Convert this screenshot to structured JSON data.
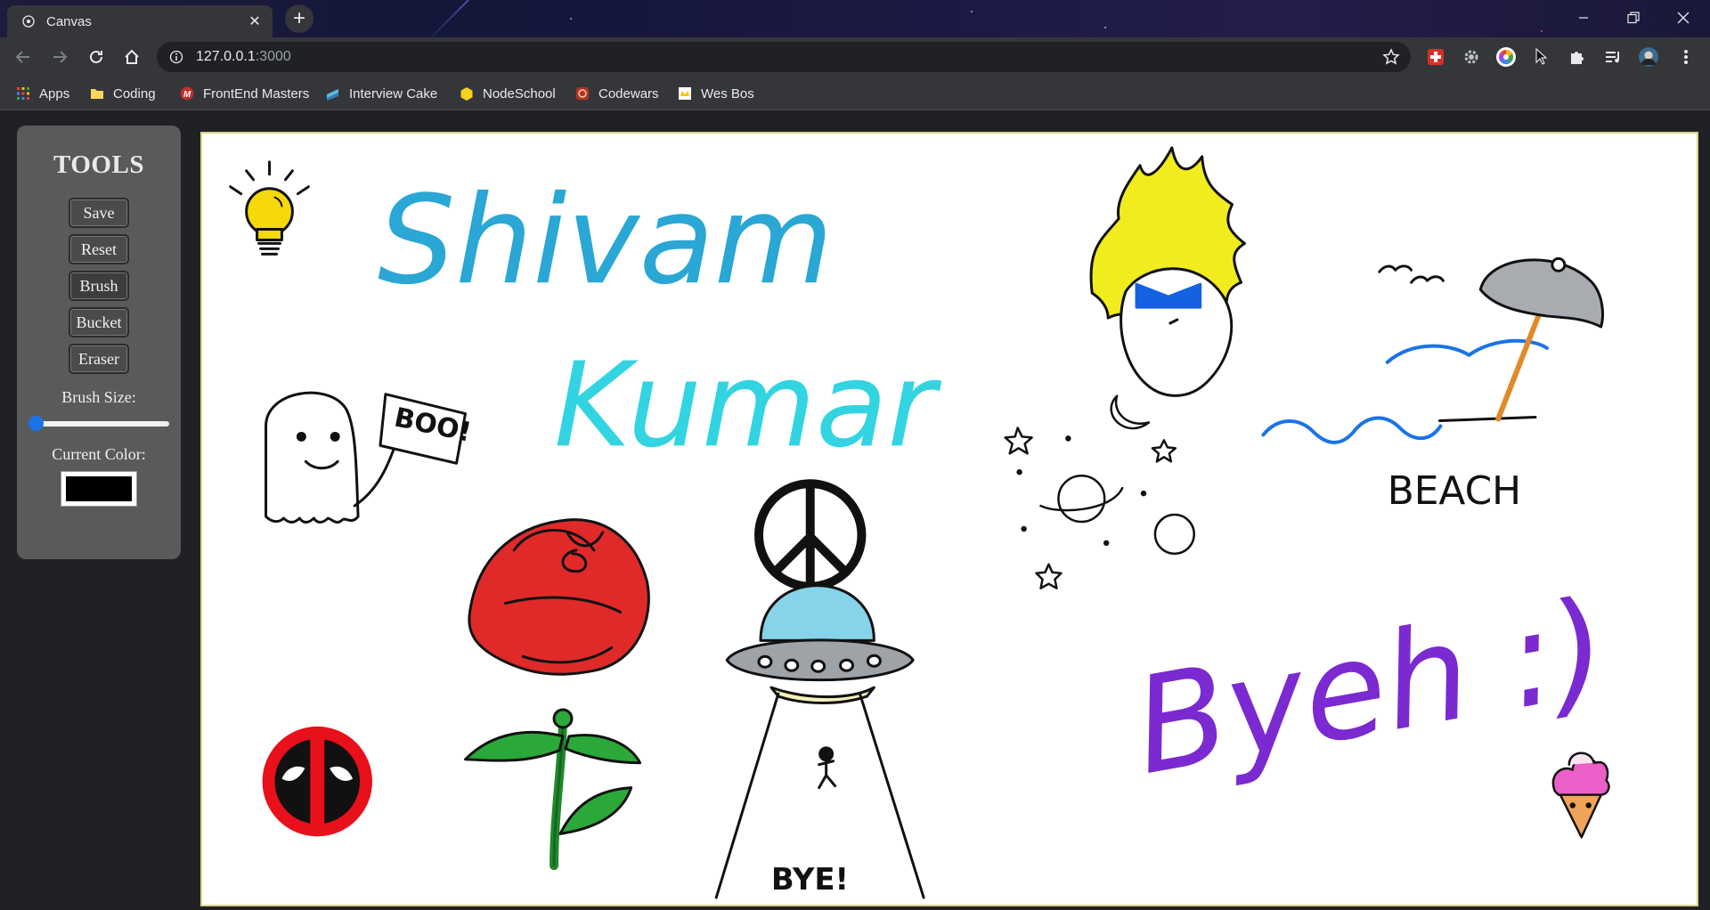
{
  "browser": {
    "tab_title": "Canvas",
    "url_host": "127.0.0.1",
    "url_port": ":3000",
    "accent": "#1a73e8"
  },
  "bookmarks": [
    {
      "label": "Apps",
      "icon": "apps-grid-icon"
    },
    {
      "label": "Coding",
      "icon": "folder-icon"
    },
    {
      "label": "FrontEnd Masters",
      "icon": "frontend-masters-icon"
    },
    {
      "label": "Interview Cake",
      "icon": "interview-cake-icon"
    },
    {
      "label": "NodeSchool",
      "icon": "nodeschool-icon"
    },
    {
      "label": "Codewars",
      "icon": "codewars-icon"
    },
    {
      "label": "Wes Bos",
      "icon": "wes-bos-icon"
    }
  ],
  "tools": {
    "title": "TOOLS",
    "buttons": [
      "Save",
      "Reset",
      "Brush",
      "Bucket",
      "Eraser"
    ],
    "active_tool": "Brush",
    "brush_size_label": "Brush Size:",
    "brush_size_value": 0,
    "current_color_label": "Current Color:",
    "current_color": "#000000"
  },
  "canvas": {
    "drawings": [
      "lightbulb",
      "handwritten name (line 1)",
      "handwritten name (line 2)",
      "spiky-haired character",
      "beach umbrella scene",
      "ghost with sign",
      "peace sign",
      "space doodles",
      "rose",
      "ufo",
      "deadpool logo",
      "purple handwriting",
      "ice cream cone"
    ],
    "text_on_canvas": {
      "name_line_1": "Shivam",
      "name_line_2": "Kumar",
      "ghost_sign": "BOO!",
      "beach": "BEACH",
      "ufo": "BYE!",
      "signoff": "Byeh :)"
    }
  }
}
